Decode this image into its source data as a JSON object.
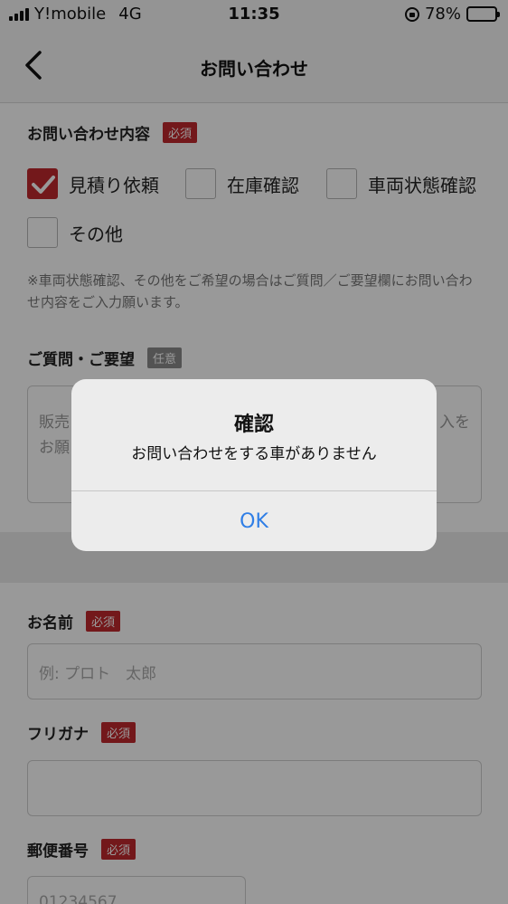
{
  "status_bar": {
    "carrier": "Y!mobile",
    "network": "4G",
    "time": "11:35",
    "battery": "78%",
    "battery_level": 0.78
  },
  "nav": {
    "title": "お問い合わせ"
  },
  "form": {
    "inquiry_label": "お問い合わせ内容",
    "required_badge": "必須",
    "optional_badge": "任意",
    "options": [
      {
        "label": "見積り依頼",
        "checked": true
      },
      {
        "label": "在庫確認",
        "checked": false
      },
      {
        "label": "車両状態確認",
        "checked": false
      },
      {
        "label": "その他",
        "checked": false
      }
    ],
    "note": "※車両状態確認、その他をご希望の場合はご質問／ご要望欄にお問い合わせ内容をご入力願います。",
    "question_label": "ご質問・ご要望",
    "question_placeholder_left": "販売",
    "question_placeholder_left2": "お願",
    "question_placeholder_right": "入を",
    "name_label": "お名前",
    "name_placeholder": "例: プロト　太郎",
    "furigana_label": "フリガナ",
    "postal_label": "郵便番号",
    "postal_placeholder": "01234567"
  },
  "alert": {
    "title": "確認",
    "message": "お問い合わせをする車がありません",
    "ok_label": "OK"
  },
  "colors": {
    "accent_red": "#c0282d",
    "ios_blue": "#2f7ee6"
  }
}
